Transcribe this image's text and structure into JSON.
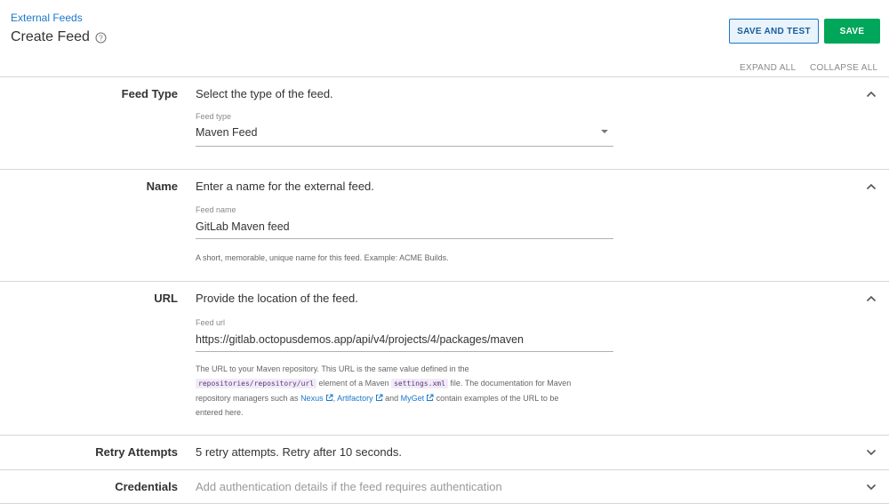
{
  "header": {
    "breadcrumb": "External Feeds",
    "title": "Create Feed",
    "save_and_test_label": "SAVE AND TEST",
    "save_label": "SAVE",
    "expand_all_label": "EXPAND ALL",
    "collapse_all_label": "COLLAPSE ALL"
  },
  "sections": {
    "feed_type": {
      "label": "Feed Type",
      "summary": "Select the type of the feed.",
      "field_label": "Feed type",
      "field_value": "Maven Feed",
      "expanded": true
    },
    "name": {
      "label": "Name",
      "summary": "Enter a name for the external feed.",
      "field_label": "Feed name",
      "field_value": "GitLab Maven feed",
      "helper": "A short, memorable, unique name for this feed. Example: ACME Builds.",
      "expanded": true
    },
    "url": {
      "label": "URL",
      "summary": "Provide the location of the feed.",
      "field_label": "Feed url",
      "field_value": "https://gitlab.octopusdemos.app/api/v4/projects/4/packages/maven",
      "helper": {
        "t1": "The URL to your Maven repository. This URL is the same value defined in the",
        "code1": "repositories/repository/url",
        "t2": " element of a Maven ",
        "code2": "settings.xml",
        "t3": " file. The documentation for Maven",
        "t4": "repository managers such as ",
        "nexus": "Nexus",
        "t5": ", ",
        "artifactory": "Artifactory",
        "t6": " and ",
        "myget": "MyGet",
        "t7": " contain examples of the URL to be",
        "t8": "entered here."
      },
      "expanded": true
    },
    "retry": {
      "label": "Retry Attempts",
      "summary": "5 retry attempts. Retry after 10 seconds.",
      "expanded": false
    },
    "credentials": {
      "label": "Credentials",
      "summary": "Add authentication details if the feed requires authentication",
      "expanded": false
    }
  },
  "colors": {
    "link": "#1a77ca",
    "save_green": "#00a65a",
    "border": "#d6d6d6"
  }
}
